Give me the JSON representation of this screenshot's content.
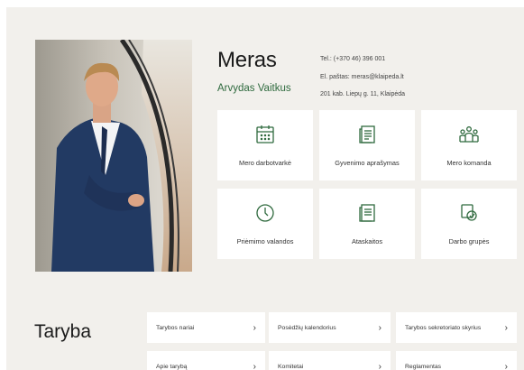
{
  "mayor": {
    "title": "Meras",
    "name": "Arvydas Vaitkus",
    "contacts": {
      "phone": "Tel.: (+370 46) 396 001",
      "email": "El. paštas: meras@klaipeda.lt",
      "address": "201 kab. Liepų g. 11, Klaipėda"
    }
  },
  "tiles": [
    {
      "label": "Mero darbotvarkė",
      "icon": "calendar-icon"
    },
    {
      "label": "Gyvenimo aprašymas",
      "icon": "document-icon"
    },
    {
      "label": "Mero komanda",
      "icon": "team-icon"
    },
    {
      "label": "Priėmimo valandos",
      "icon": "clock-icon"
    },
    {
      "label": "Ataskaitos",
      "icon": "report-icon"
    },
    {
      "label": "Darbo grupės",
      "icon": "workgroup-icon"
    }
  ],
  "council": {
    "title": "Taryba",
    "links": [
      {
        "label": "Tarybos nariai"
      },
      {
        "label": "Posėdžių kalendorius"
      },
      {
        "label": "Tarybos sekretoriato skyrius"
      },
      {
        "label": "Apie tarybą"
      },
      {
        "label": "Komitetai"
      },
      {
        "label": "Reglamentas"
      }
    ]
  },
  "colors": {
    "accent": "#2f6a3e",
    "background": "#f2f0ec",
    "tile": "#ffffff"
  }
}
